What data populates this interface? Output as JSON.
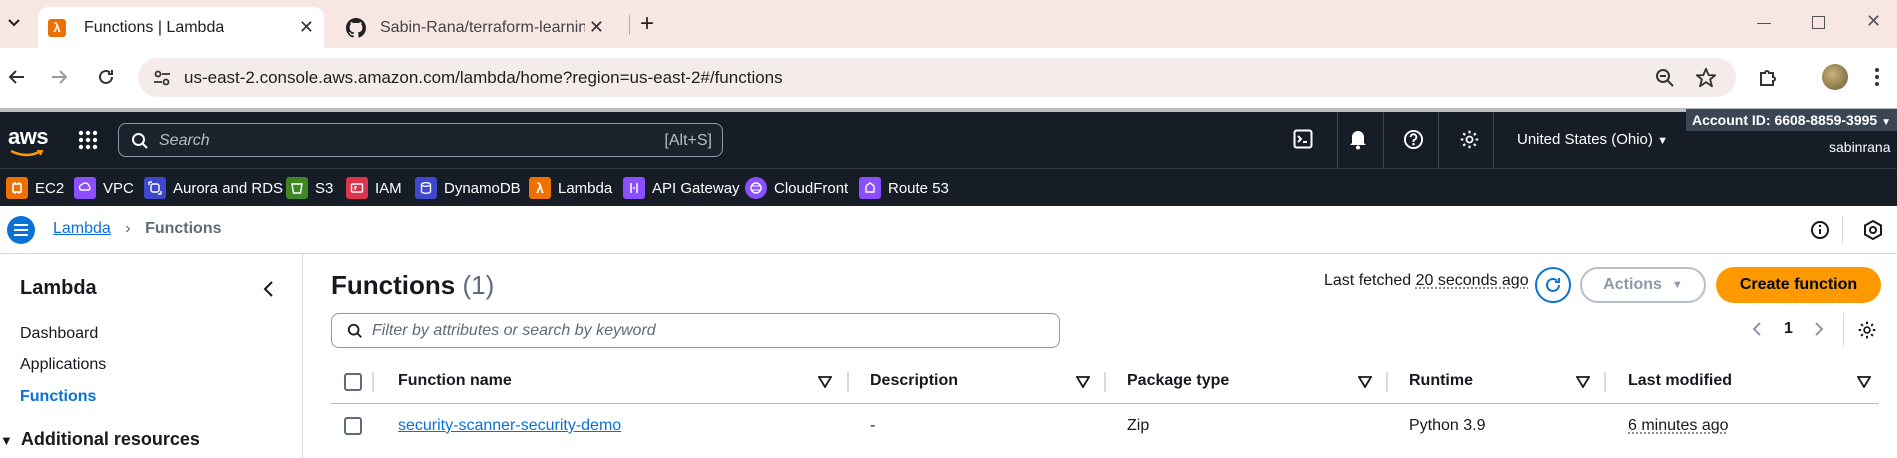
{
  "browser": {
    "tabs": [
      {
        "title": "Functions | Lambda",
        "active": true
      },
      {
        "title": "Sabin-Rana/terraform-learning",
        "active": false
      }
    ],
    "url": "us-east-2.console.aws.amazon.com/lambda/home?region=us-east-2#/functions"
  },
  "aws_header": {
    "logo": "aws",
    "search_placeholder": "Search",
    "search_shortcut": "[Alt+S]",
    "region": "United States (Ohio)",
    "account_id": "Account ID: 6608-8859-3995",
    "username": "sabinrana"
  },
  "favorites": [
    {
      "label": "EC2",
      "color": "#ed7100",
      "icon": "ec2-icon"
    },
    {
      "label": "VPC",
      "color": "#8c4fff",
      "icon": "vpc-icon"
    },
    {
      "label": "Aurora and RDS",
      "color": "#3f48cc",
      "icon": "rds-icon"
    },
    {
      "label": "S3",
      "color": "#3f8624",
      "icon": "s3-icon"
    },
    {
      "label": "IAM",
      "color": "#dd344c",
      "icon": "iam-icon"
    },
    {
      "label": "DynamoDB",
      "color": "#3f48cc",
      "icon": "dynamodb-icon"
    },
    {
      "label": "Lambda",
      "color": "#ed7100",
      "icon": "lambda-icon"
    },
    {
      "label": "API Gateway",
      "color": "#8c4fff",
      "icon": "api-gateway-icon"
    },
    {
      "label": "CloudFront",
      "color": "#8c4fff",
      "icon": "cloudfront-icon"
    },
    {
      "label": "Route 53",
      "color": "#8c4fff",
      "icon": "route53-icon"
    }
  ],
  "breadcrumb": {
    "root": "Lambda",
    "current": "Functions"
  },
  "sidenav": {
    "title": "Lambda",
    "items": [
      {
        "label": "Dashboard",
        "active": false
      },
      {
        "label": "Applications",
        "active": false
      },
      {
        "label": "Functions",
        "active": true
      }
    ],
    "section": "Additional resources"
  },
  "main": {
    "title": "Functions",
    "count": "(1)",
    "last_fetched_prefix": "Last fetched",
    "last_fetched_value": "20 seconds ago",
    "actions_label": "Actions",
    "create_label": "Create function",
    "filter_placeholder": "Filter by attributes or search by keyword",
    "page_number": "1"
  },
  "table": {
    "columns": [
      "Function name",
      "Description",
      "Package type",
      "Runtime",
      "Last modified"
    ],
    "rows": [
      {
        "function_name": "security-scanner-security-demo",
        "description": "-",
        "package_type": "Zip",
        "runtime": "Python 3.9",
        "last_modified": "6 minutes ago"
      }
    ]
  },
  "colors": {
    "aws_dark": "#161d26",
    "primary_orange": "#ff9900",
    "link_blue": "#0972d3"
  }
}
